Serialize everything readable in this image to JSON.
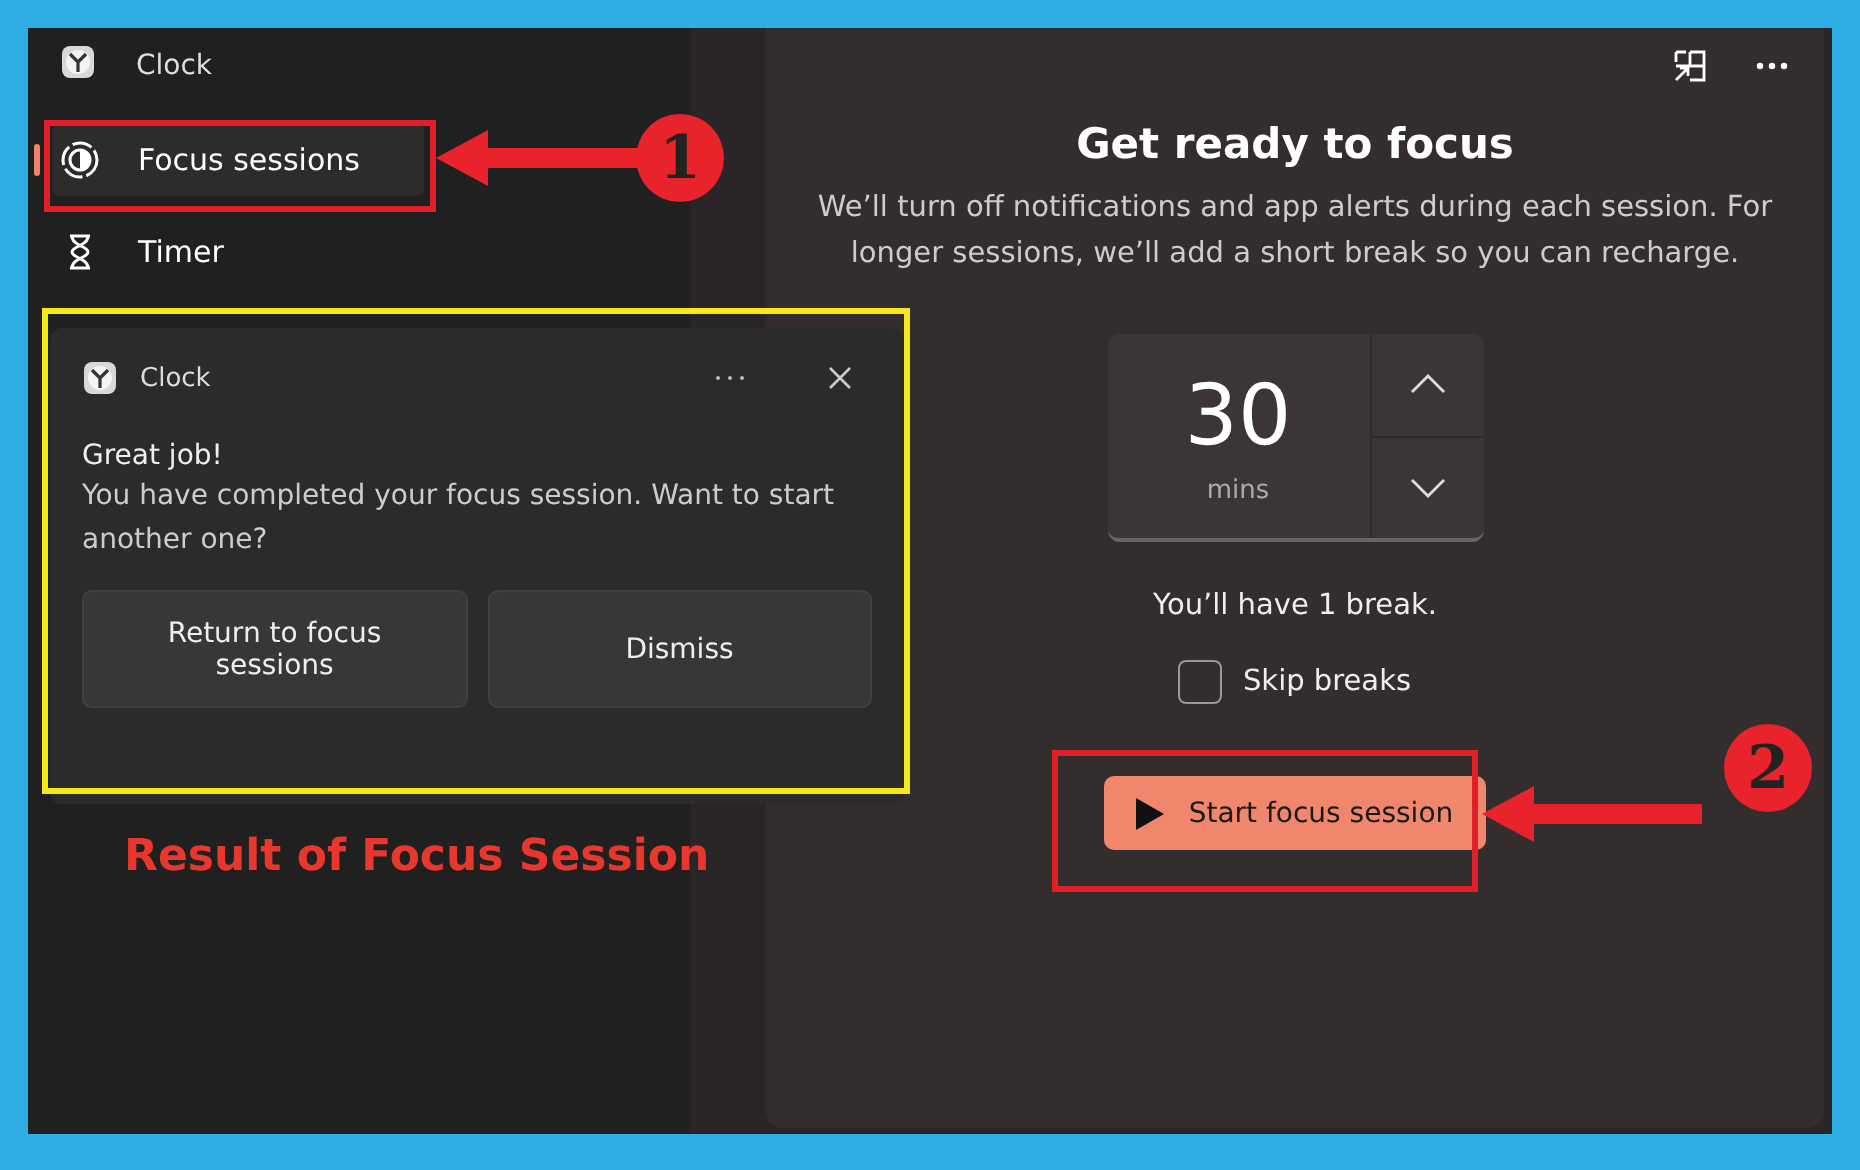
{
  "app": {
    "title": "Clock"
  },
  "nav": [
    {
      "label": "Focus sessions",
      "selected": true,
      "kind": "focus"
    },
    {
      "label": "Timer",
      "selected": false,
      "kind": "timer"
    }
  ],
  "toast": {
    "app": "Clock",
    "title": "Great job!",
    "message": "You have completed your focus session. Want to start another one?",
    "buttons": [
      "Return to focus sessions",
      "Dismiss"
    ]
  },
  "focus": {
    "title": "Get ready to focus",
    "description": "We’ll turn off notifications and app alerts during each session. For longer sessions, we’ll add a short break so you can recharge.",
    "minutes": "30",
    "unit": "mins",
    "break_note": "You’ll have 1 break.",
    "skip_breaks": {
      "label": "Skip breaks",
      "checked": false
    },
    "start_button": "Start focus session"
  },
  "annotations": [
    {
      "number": "1"
    },
    {
      "number": "2"
    }
  ],
  "caption": "Result of Focus Session"
}
